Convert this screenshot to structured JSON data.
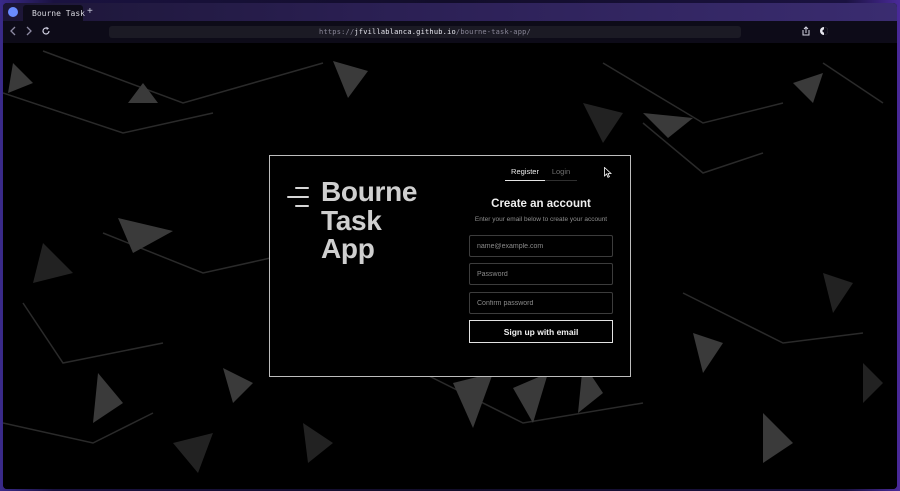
{
  "browser": {
    "tab_title": "Bourne Task",
    "new_tab_glyph": "+",
    "url_scheme": "https://",
    "url_host": "jfvillablanca.github.io",
    "url_path": "/bourne-task-app/",
    "icons": [
      "app-icon",
      "tab-favicon",
      "new-tab-icon",
      "back-icon",
      "forward-icon",
      "reload-icon",
      "share-icon",
      "extension-icon"
    ]
  },
  "app": {
    "brand_lines": [
      "Bourne",
      "Task",
      "App"
    ],
    "tabs": {
      "register": "Register",
      "login": "Login",
      "active": "register"
    },
    "form": {
      "title": "Create an account",
      "subtitle": "Enter your email below to create your account",
      "email_placeholder": "name@example.com",
      "password_placeholder": "Password",
      "confirm_placeholder": "Confirm password",
      "submit_label": "Sign up with email"
    }
  },
  "colors": {
    "page_background": "#000000",
    "card_border": "#bdbdbd",
    "brand_text": "#cfcfcf",
    "accent_frame": "#3a2c70"
  }
}
